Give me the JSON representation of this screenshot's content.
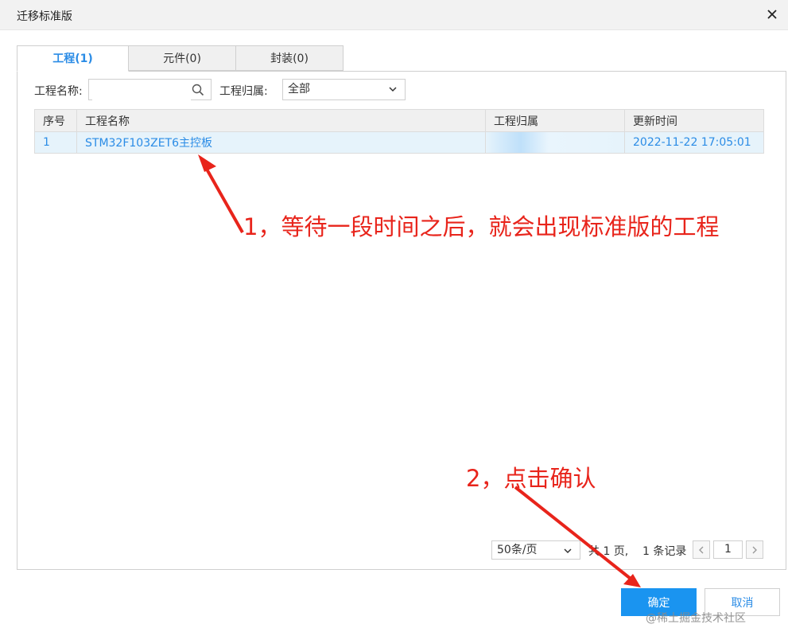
{
  "window": {
    "title": "迁移标准版"
  },
  "tabs": [
    {
      "label": "工程(1)"
    },
    {
      "label": "元件(0)"
    },
    {
      "label": "封装(0)"
    }
  ],
  "filters": {
    "name_label": "工程名称:",
    "name_value": "",
    "owner_label": "工程归属:",
    "owner_selected": "全部"
  },
  "table": {
    "headers": [
      "序号",
      "工程名称",
      "工程归属",
      "更新时间"
    ],
    "rows": [
      {
        "index": "1",
        "name": "STM32F103ZET6主控板",
        "owner": "",
        "updated": "2022-11-22 17:05:01"
      }
    ]
  },
  "annotations": {
    "note1": "1，等待一段时间之后，就会出现标准版的工程",
    "note2": "2，点击确认",
    "color": "#e8241b"
  },
  "pagination": {
    "page_size": "50条/页",
    "summary_total_pages": "共 1 页,",
    "summary_records": "1 条记录",
    "current_page": "1"
  },
  "buttons": {
    "ok": "确定",
    "cancel": "取消"
  },
  "watermark": "@稀土掘金技术社区",
  "colors": {
    "accent": "#2b8ce6",
    "primary_button": "#1a94f0"
  }
}
